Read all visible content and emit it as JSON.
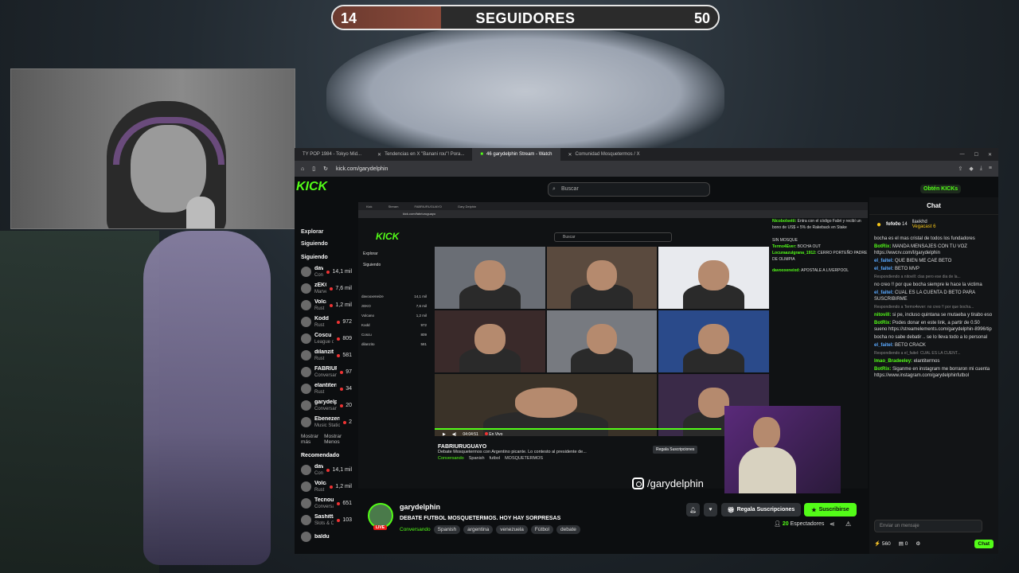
{
  "overlay": {
    "followers_current": "14",
    "followers_label": "SEGUIDORES",
    "followers_goal": "50",
    "progress_fraction": 0.28,
    "instagram_handle": "/garydelphin"
  },
  "browser": {
    "tabs": [
      "TY POP 1984 - Tokyo Mid...",
      "Tendencias en X \"Banani rou\"! Pora...",
      "46 garydelphin Stream - Watch",
      "Comunidad Mosquetermos / X"
    ],
    "url": "kick.com/garydelphin"
  },
  "kick": {
    "logo": "KICK",
    "search_placeholder": "Buscar",
    "get_kicks": "Obtén KICKs",
    "nav": [
      "Explorar",
      "Siguiendo"
    ],
    "following_header": "Siguiendo",
    "following": [
      {
        "name": "davooxeneize",
        "category": "Conversando",
        "viewers": "14,1 mil"
      },
      {
        "name": "zEKO",
        "category": "Marvel Rivals",
        "viewers": "7,6 mil"
      },
      {
        "name": "Volcano",
        "category": "Rust",
        "viewers": "1,2 mil"
      },
      {
        "name": "Kodd",
        "category": "Rust",
        "viewers": "972"
      },
      {
        "name": "Coscu",
        "category": "League of Legends",
        "viewers": "809"
      },
      {
        "name": "dilanzito",
        "category": "Rust",
        "viewers": "581"
      },
      {
        "name": "FABRIURUGUAYO",
        "category": "Conversando",
        "viewers": "97"
      },
      {
        "name": "elantitermos",
        "category": "Rust",
        "viewers": "34"
      },
      {
        "name": "garydelphin",
        "category": "Conversando",
        "viewers": "20"
      },
      {
        "name": "Ebenezermda",
        "category": "Music Stations",
        "viewers": "2"
      }
    ],
    "show_more": "Mostrar más",
    "show_less": "Mostrar Menos",
    "recommended_header": "Recomendado",
    "recommended": [
      {
        "name": "davooxeneize",
        "category": "Conversando",
        "viewers": "14,1 mil"
      },
      {
        "name": "Volcano",
        "category": "Rust",
        "viewers": "1,2 mil"
      },
      {
        "name": "Tecnouniversit...",
        "category": "Conversando",
        "viewers": "651"
      },
      {
        "name": "Sashittaa",
        "category": "Slots & Casino",
        "viewers": "103"
      },
      {
        "name": "baldu",
        "category": "",
        "viewers": ""
      }
    ]
  },
  "nested": {
    "streamer": "FABRIURUGUAYO",
    "title": "Debate Mosquetermos con Argentino picante. Lo contesto al presidente de...",
    "tags": [
      "Conversando",
      "Spanish",
      "futbol",
      "MOSQUETERMOS"
    ],
    "time": "04:04:51",
    "live_label": "En Vivo",
    "gift_label": "Regala Suscripciones"
  },
  "stream": {
    "channel": "garydelphin",
    "live": "LIVE",
    "title": "DEBATE FUTBOL MOSQUETERMOS. HOY HAY SORPRESAS",
    "category": "Conversando",
    "tags": [
      "Spanish",
      "argentina",
      "venezuela",
      "Fútbol",
      "debate"
    ],
    "gift_button": "Regala Suscripciones",
    "subscribe_button": "Suscribirse",
    "viewers_count": "20",
    "viewers_label": "Espectadores"
  },
  "chat": {
    "header": "Chat",
    "pinned": [
      {
        "name": "fofo0o",
        "count": "14"
      },
      {
        "name": "llaekhd",
        "count": ""
      },
      {
        "name": "Vegacast",
        "count": "6"
      }
    ],
    "messages": [
      {
        "user": "",
        "text": "bocha es el mas cristal de todos los fundadores",
        "cls": ""
      },
      {
        "user": "BotRix:",
        "text": "MANDA MENSAJES CON TU VOZ https://wwcrv.com/l/garydelphin",
        "cls": ""
      },
      {
        "user": "el_faitel:",
        "text": "QUE BIEN ME CAE BETO",
        "cls": "blue"
      },
      {
        "user": "el_faitel:",
        "text": "BETO MVP",
        "cls": "blue"
      },
      {
        "user": "",
        "text": "Respondiendo a nitovill: clas pero ese dia de la...",
        "cls": "sys"
      },
      {
        "user": "",
        "text": "no creo !! por que bocha siempre le hace la victima",
        "cls": "red"
      },
      {
        "user": "el_faitel:",
        "text": "CUAL ES LA CUENTA D BETO PARA SUSCRIBIRME",
        "cls": "blue"
      },
      {
        "user": "",
        "text": "Respondiendo a Termo4ever: no creo !! por que bocha...",
        "cls": "sys"
      },
      {
        "user": "nitovill:",
        "text": "si pe, incluso quintana se mutaeba y tirabo eso",
        "cls": ""
      },
      {
        "user": "BotRix:",
        "text": "Podes donar en este link, a partir de 0.50 sueno https://streamelements.com/garydelphin-8996/tip",
        "cls": ""
      },
      {
        "user": "",
        "text": "bocha no sabe debatir .. se lo lleva todo a lo personal",
        "cls": "red"
      },
      {
        "user": "el_faitel:",
        "text": "BETO CRACK",
        "cls": "blue"
      },
      {
        "user": "",
        "text": "Respondiendo a el_faitel: CUAL ES LA CUENT...",
        "cls": "sys"
      },
      {
        "user": "lmao_Bradeeley:",
        "text": "elantitermos",
        "cls": ""
      },
      {
        "user": "BotRix:",
        "text": "Siganme en instagram me borraron mi cuenta https://www.instagram.com/garydelphinfutbol",
        "cls": ""
      }
    ],
    "input_placeholder": "Enviar un mensaje",
    "points": "560",
    "other_count": "0",
    "send_label": "Chat"
  }
}
